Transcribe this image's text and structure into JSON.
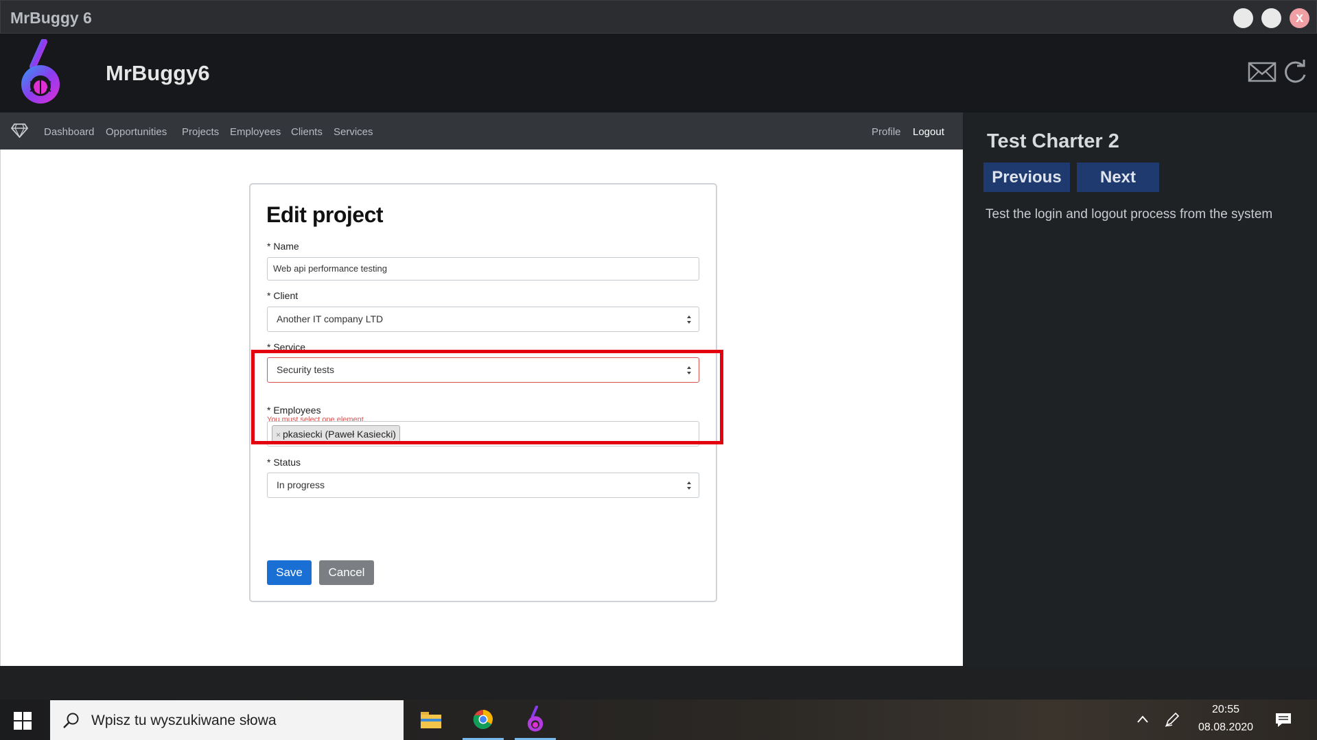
{
  "window": {
    "title": "MrBuggy 6",
    "close_glyph": "x"
  },
  "header": {
    "brand": "MrBuggy6",
    "icons": [
      "mail-icon",
      "refresh-icon"
    ]
  },
  "nav": {
    "items": [
      {
        "label": "Dashboard"
      },
      {
        "label": "Opportunities"
      },
      {
        "label": "Projects"
      },
      {
        "label": "Employees"
      },
      {
        "label": "Clients"
      },
      {
        "label": "Services"
      }
    ],
    "profile": "Profile",
    "logout": "Logout"
  },
  "form": {
    "title": "Edit project",
    "name_label": "* Name",
    "name_value": "Web api performance testing",
    "client_label": "* Client",
    "client_value": "Another IT company LTD",
    "service_label": "* Service",
    "service_value": "Security tests",
    "service_error": "You must select one element.",
    "employees_label": "* Employees",
    "employees_tags": [
      {
        "remove": "×",
        "text": "pkasiecki (Paweł Kasiecki)"
      }
    ],
    "status_label": "* Status",
    "status_value": "In progress",
    "save_label": "Save",
    "cancel_label": "Cancel"
  },
  "side_panel": {
    "title": "Test Charter 2",
    "previous_label": "Previous",
    "next_label": "Next",
    "description": "Test the login and logout process from the system"
  },
  "taskbar": {
    "search_placeholder": "Wpisz tu wyszukiwane słowa",
    "time": "20:55",
    "date": "08.08.2020",
    "apps": [
      "file-explorer-icon",
      "chrome-icon",
      "mrbuggy-icon"
    ]
  },
  "colors": {
    "accent_primary": "#1a6fd4",
    "error": "#d9534f",
    "highlight": "#e3000f",
    "side_button": "#1e3a6e"
  }
}
